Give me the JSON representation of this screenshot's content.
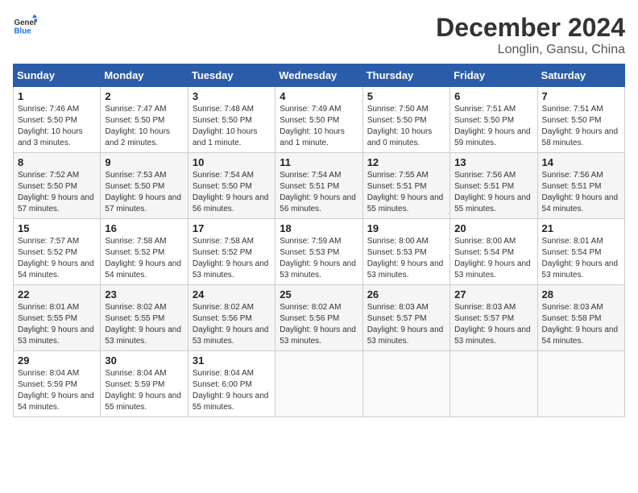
{
  "logo": {
    "line1": "General",
    "line2": "Blue"
  },
  "title": "December 2024",
  "subtitle": "Longlin, Gansu, China",
  "weekdays": [
    "Sunday",
    "Monday",
    "Tuesday",
    "Wednesday",
    "Thursday",
    "Friday",
    "Saturday"
  ],
  "weeks": [
    [
      {
        "day": "1",
        "sunrise": "Sunrise: 7:46 AM",
        "sunset": "Sunset: 5:50 PM",
        "daylight": "Daylight: 10 hours and 3 minutes."
      },
      {
        "day": "2",
        "sunrise": "Sunrise: 7:47 AM",
        "sunset": "Sunset: 5:50 PM",
        "daylight": "Daylight: 10 hours and 2 minutes."
      },
      {
        "day": "3",
        "sunrise": "Sunrise: 7:48 AM",
        "sunset": "Sunset: 5:50 PM",
        "daylight": "Daylight: 10 hours and 1 minute."
      },
      {
        "day": "4",
        "sunrise": "Sunrise: 7:49 AM",
        "sunset": "Sunset: 5:50 PM",
        "daylight": "Daylight: 10 hours and 1 minute."
      },
      {
        "day": "5",
        "sunrise": "Sunrise: 7:50 AM",
        "sunset": "Sunset: 5:50 PM",
        "daylight": "Daylight: 10 hours and 0 minutes."
      },
      {
        "day": "6",
        "sunrise": "Sunrise: 7:51 AM",
        "sunset": "Sunset: 5:50 PM",
        "daylight": "Daylight: 9 hours and 59 minutes."
      },
      {
        "day": "7",
        "sunrise": "Sunrise: 7:51 AM",
        "sunset": "Sunset: 5:50 PM",
        "daylight": "Daylight: 9 hours and 58 minutes."
      }
    ],
    [
      {
        "day": "8",
        "sunrise": "Sunrise: 7:52 AM",
        "sunset": "Sunset: 5:50 PM",
        "daylight": "Daylight: 9 hours and 57 minutes."
      },
      {
        "day": "9",
        "sunrise": "Sunrise: 7:53 AM",
        "sunset": "Sunset: 5:50 PM",
        "daylight": "Daylight: 9 hours and 57 minutes."
      },
      {
        "day": "10",
        "sunrise": "Sunrise: 7:54 AM",
        "sunset": "Sunset: 5:50 PM",
        "daylight": "Daylight: 9 hours and 56 minutes."
      },
      {
        "day": "11",
        "sunrise": "Sunrise: 7:54 AM",
        "sunset": "Sunset: 5:51 PM",
        "daylight": "Daylight: 9 hours and 56 minutes."
      },
      {
        "day": "12",
        "sunrise": "Sunrise: 7:55 AM",
        "sunset": "Sunset: 5:51 PM",
        "daylight": "Daylight: 9 hours and 55 minutes."
      },
      {
        "day": "13",
        "sunrise": "Sunrise: 7:56 AM",
        "sunset": "Sunset: 5:51 PM",
        "daylight": "Daylight: 9 hours and 55 minutes."
      },
      {
        "day": "14",
        "sunrise": "Sunrise: 7:56 AM",
        "sunset": "Sunset: 5:51 PM",
        "daylight": "Daylight: 9 hours and 54 minutes."
      }
    ],
    [
      {
        "day": "15",
        "sunrise": "Sunrise: 7:57 AM",
        "sunset": "Sunset: 5:52 PM",
        "daylight": "Daylight: 9 hours and 54 minutes."
      },
      {
        "day": "16",
        "sunrise": "Sunrise: 7:58 AM",
        "sunset": "Sunset: 5:52 PM",
        "daylight": "Daylight: 9 hours and 54 minutes."
      },
      {
        "day": "17",
        "sunrise": "Sunrise: 7:58 AM",
        "sunset": "Sunset: 5:52 PM",
        "daylight": "Daylight: 9 hours and 53 minutes."
      },
      {
        "day": "18",
        "sunrise": "Sunrise: 7:59 AM",
        "sunset": "Sunset: 5:53 PM",
        "daylight": "Daylight: 9 hours and 53 minutes."
      },
      {
        "day": "19",
        "sunrise": "Sunrise: 8:00 AM",
        "sunset": "Sunset: 5:53 PM",
        "daylight": "Daylight: 9 hours and 53 minutes."
      },
      {
        "day": "20",
        "sunrise": "Sunrise: 8:00 AM",
        "sunset": "Sunset: 5:54 PM",
        "daylight": "Daylight: 9 hours and 53 minutes."
      },
      {
        "day": "21",
        "sunrise": "Sunrise: 8:01 AM",
        "sunset": "Sunset: 5:54 PM",
        "daylight": "Daylight: 9 hours and 53 minutes."
      }
    ],
    [
      {
        "day": "22",
        "sunrise": "Sunrise: 8:01 AM",
        "sunset": "Sunset: 5:55 PM",
        "daylight": "Daylight: 9 hours and 53 minutes."
      },
      {
        "day": "23",
        "sunrise": "Sunrise: 8:02 AM",
        "sunset": "Sunset: 5:55 PM",
        "daylight": "Daylight: 9 hours and 53 minutes."
      },
      {
        "day": "24",
        "sunrise": "Sunrise: 8:02 AM",
        "sunset": "Sunset: 5:56 PM",
        "daylight": "Daylight: 9 hours and 53 minutes."
      },
      {
        "day": "25",
        "sunrise": "Sunrise: 8:02 AM",
        "sunset": "Sunset: 5:56 PM",
        "daylight": "Daylight: 9 hours and 53 minutes."
      },
      {
        "day": "26",
        "sunrise": "Sunrise: 8:03 AM",
        "sunset": "Sunset: 5:57 PM",
        "daylight": "Daylight: 9 hours and 53 minutes."
      },
      {
        "day": "27",
        "sunrise": "Sunrise: 8:03 AM",
        "sunset": "Sunset: 5:57 PM",
        "daylight": "Daylight: 9 hours and 53 minutes."
      },
      {
        "day": "28",
        "sunrise": "Sunrise: 8:03 AM",
        "sunset": "Sunset: 5:58 PM",
        "daylight": "Daylight: 9 hours and 54 minutes."
      }
    ],
    [
      {
        "day": "29",
        "sunrise": "Sunrise: 8:04 AM",
        "sunset": "Sunset: 5:59 PM",
        "daylight": "Daylight: 9 hours and 54 minutes."
      },
      {
        "day": "30",
        "sunrise": "Sunrise: 8:04 AM",
        "sunset": "Sunset: 5:59 PM",
        "daylight": "Daylight: 9 hours and 55 minutes."
      },
      {
        "day": "31",
        "sunrise": "Sunrise: 8:04 AM",
        "sunset": "Sunset: 6:00 PM",
        "daylight": "Daylight: 9 hours and 55 minutes."
      },
      null,
      null,
      null,
      null
    ]
  ]
}
